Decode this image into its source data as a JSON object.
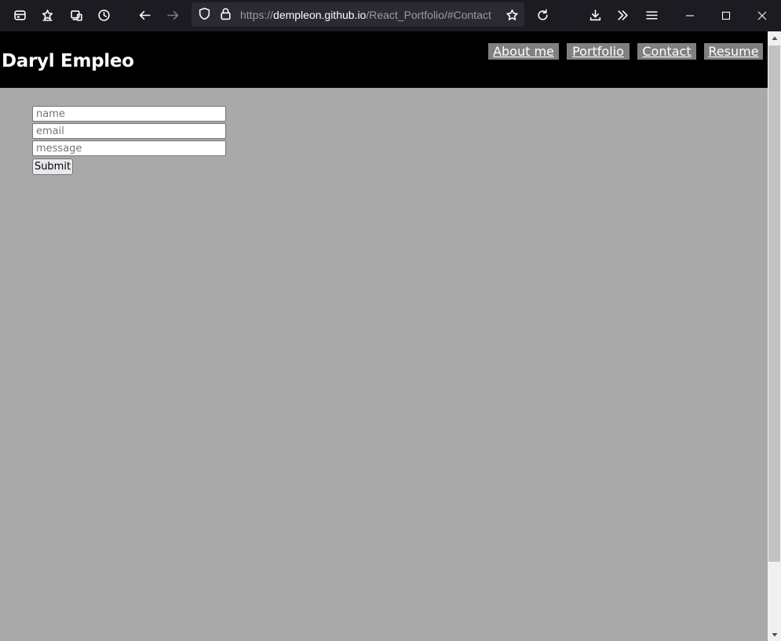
{
  "browser": {
    "url_scheme": "https://",
    "url_host": "dempleon.github.io",
    "url_path": "/React_Portfolio/#Contact",
    "icons": [
      "firefox-view-icon",
      "bookmarks-icon",
      "synced-tabs-icon",
      "history-icon",
      "back-icon",
      "forward-icon",
      "shield-icon",
      "lock-icon",
      "bookmark-star-icon",
      "reload-icon",
      "downloads-icon",
      "overflow-icon",
      "menu-icon",
      "minimize-icon",
      "maximize-icon",
      "close-icon"
    ]
  },
  "site": {
    "title": "Daryl Empleo",
    "nav": [
      {
        "label": "About me"
      },
      {
        "label": "Portfolio"
      },
      {
        "label": "Contact"
      },
      {
        "label": "Resume"
      }
    ]
  },
  "form": {
    "name_placeholder": "name",
    "email_placeholder": "email",
    "message_placeholder": "message",
    "name_value": "",
    "email_value": "",
    "message_value": "",
    "submit_label": "Submit"
  },
  "colors": {
    "header_bg": "#000000",
    "page_bg": "#a9a9a9",
    "nav_bg": "#808080",
    "browser_chrome": "#1c1b22"
  }
}
